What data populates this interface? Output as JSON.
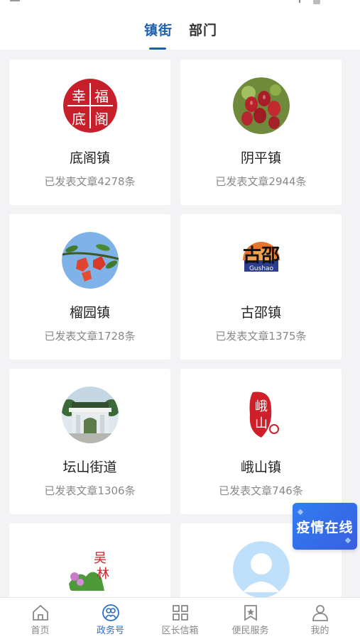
{
  "header": {
    "tabs": [
      {
        "label": "镇街",
        "active": true
      },
      {
        "label": "部门",
        "active": false
      }
    ],
    "accent_color": "#1e5fae"
  },
  "orgs": [
    {
      "name": "底阁镇",
      "count": "已发表文章4278条",
      "logo_text": "幸福底阁"
    },
    {
      "name": "阴平镇",
      "count": "已发表文章2944条"
    },
    {
      "name": "榴园镇",
      "count": "已发表文章1728条"
    },
    {
      "name": "古邵镇",
      "count": "已发表文章1375条",
      "logo_text": "古邵",
      "logo_sub": "Gushao"
    },
    {
      "name": "坛山街道",
      "count": "已发表文章1306条"
    },
    {
      "name": "峨山镇",
      "count": "已发表文章746条",
      "logo_text": "峨山"
    },
    {
      "name": "",
      "count": "",
      "logo_text": "吴林"
    },
    {
      "name": "",
      "count": ""
    }
  ],
  "floating": {
    "label": "疫情在线"
  },
  "bottom_nav": [
    {
      "label": "首页",
      "icon": "home-icon",
      "active": false
    },
    {
      "label": "政务号",
      "icon": "government-icon",
      "active": true
    },
    {
      "label": "区长信箱",
      "icon": "grid-icon",
      "active": false
    },
    {
      "label": "便民服务",
      "icon": "bookmark-star-icon",
      "active": false
    },
    {
      "label": "我的",
      "icon": "user-icon",
      "active": false
    }
  ]
}
